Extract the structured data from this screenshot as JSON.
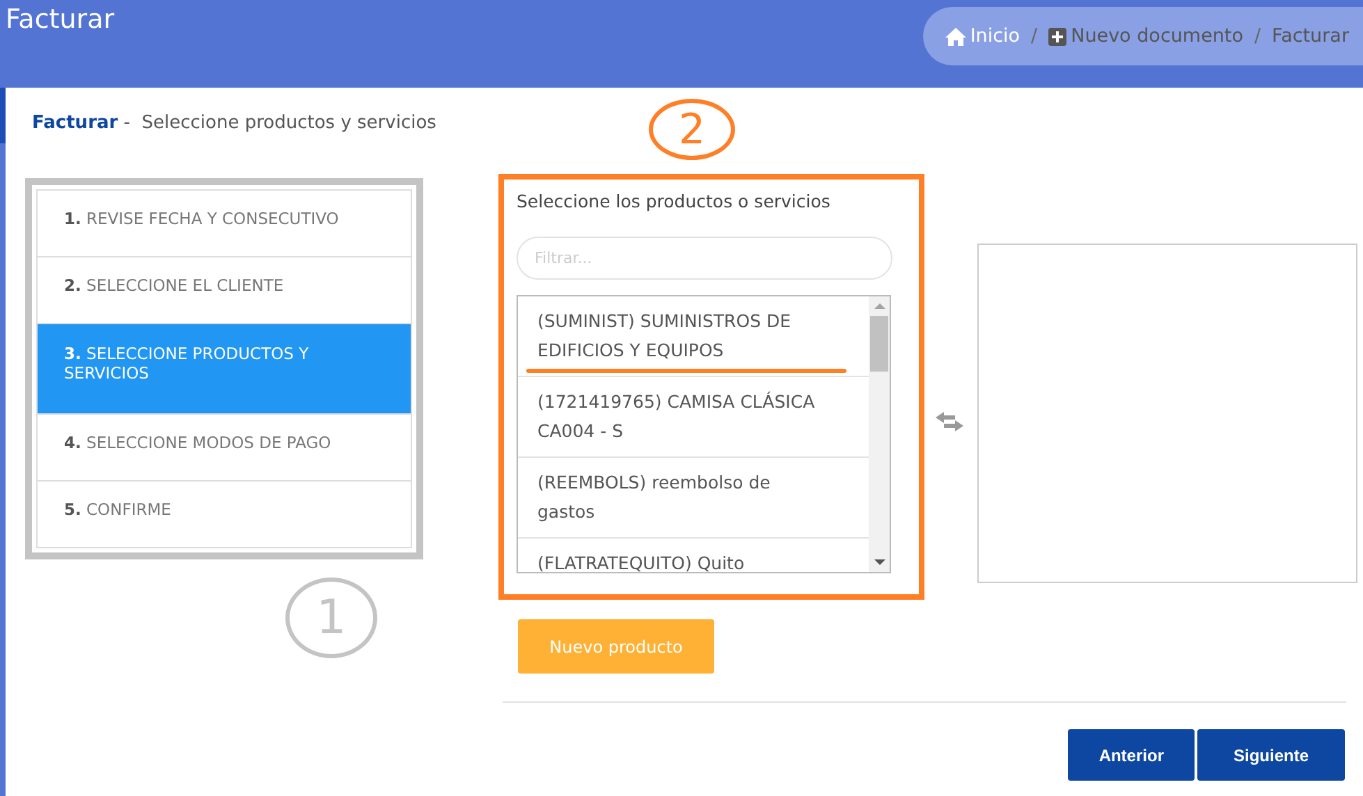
{
  "header": {
    "title": "Facturar",
    "breadcrumb": [
      {
        "label": "Inicio",
        "kind": "home",
        "highlighted": true
      },
      {
        "label": "Nuevo documento",
        "kind": "add",
        "highlighted": false
      },
      {
        "label": "Facturar",
        "kind": "plain",
        "highlighted": false
      }
    ],
    "separators": [
      "/",
      "/"
    ]
  },
  "card": {
    "title": "Facturar",
    "separator": "-",
    "subtitle": "Seleccione productos y servicios"
  },
  "steps": [
    {
      "number": "1.",
      "label": "REVISE FECHA Y CONSECUTIVO",
      "selected": false
    },
    {
      "number": "2.",
      "label": "SELECCIONE EL CLIENTE",
      "selected": false
    },
    {
      "number": "3.",
      "label": "SELECCIONE PRODUCTOS Y SERVICIOS",
      "selected": true
    },
    {
      "number": "4.",
      "label": "SELECCIONE MODOS DE PAGO",
      "selected": false
    },
    {
      "number": "5.",
      "label": "CONFIRME",
      "selected": false
    }
  ],
  "products": {
    "heading": "Seleccione los productos o servicios",
    "filter": {
      "placeholder": "Filtrar..."
    },
    "items": [
      {
        "label": "(SUMINIST) SUMINISTROS DE EDIFICIOS Y EQUIPOS",
        "underlined": true
      },
      {
        "label": "(1721419765) CAMISA CLÁSICA CA004 - S",
        "underlined": false
      },
      {
        "label": "(REEMBOLS) reembolso de gastos",
        "underlined": false
      },
      {
        "label": "(FLATRATEQUITO) Quito",
        "underlined": false
      }
    ]
  },
  "new_button": "Nuevo producto",
  "nav_buttons": [
    "Anterior",
    "Siguiente"
  ],
  "annotations": [
    {
      "label": "1",
      "color": "#c4c4c4"
    },
    {
      "label": "2",
      "color": "#ff7f27"
    }
  ]
}
